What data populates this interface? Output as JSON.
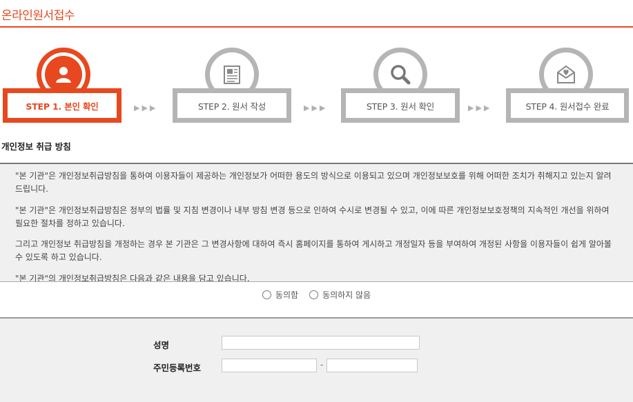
{
  "page": {
    "title": "온라인원서접수"
  },
  "steps": [
    {
      "label": "STEP 1. 본인 확인",
      "icon": "user-icon",
      "active": true
    },
    {
      "label": "STEP 2. 원서 작성",
      "icon": "document-icon",
      "active": false
    },
    {
      "label": "STEP 3. 원서 확인",
      "icon": "magnifier-icon",
      "active": false
    },
    {
      "label": "STEP 4. 원서접수 완료",
      "icon": "heart-mail-icon",
      "active": false
    }
  ],
  "step_arrow": "▶▶▶",
  "policy": {
    "title": "개인정보 취급 방침",
    "paragraphs": [
      "\"본 기관\"은 개인정보취급방침을 통하여 이용자들이 제공하는 개인정보가 어떠한 용도의 방식으로 이용되고 있으며 개인정보보호를 위해 어떠한 조치가 취해지고 있는지 알려드립니다.",
      "\"본 기관\"은 개인정보취급방침은 정부의 법률 및 지침 변경이나 내부 방침 변경 등으로 인하여 수시로 변경될 수 있고, 이에 따른 개인정보보호정책의 지속적인 개선을 위하여 필요한 절차를 정하고 있습니다.",
      "그리고 개인정보 취급방침을 개정하는 경우 본 기관은 그 변경사항에 대하여 즉시 홈페이지를 통하여 게시하고 개정일자 등을 부여하여 개정된 사항을 이용자들이 쉽게 알아볼 수 있도록 하고 있습니다.",
      "\"본 기관\"의 개인정보취급방침은 다음과 같은 내용을 담고 있습니다."
    ]
  },
  "consent": {
    "agree": "동의함",
    "disagree": "동의하지 않음"
  },
  "form": {
    "name_label": "성명",
    "name_value": "",
    "id_label": "주민등록번호",
    "id_first": "",
    "id_separator": "-",
    "id_second": ""
  },
  "colors": {
    "accent": "#e8481f",
    "inactive": "#b5b5b5"
  }
}
